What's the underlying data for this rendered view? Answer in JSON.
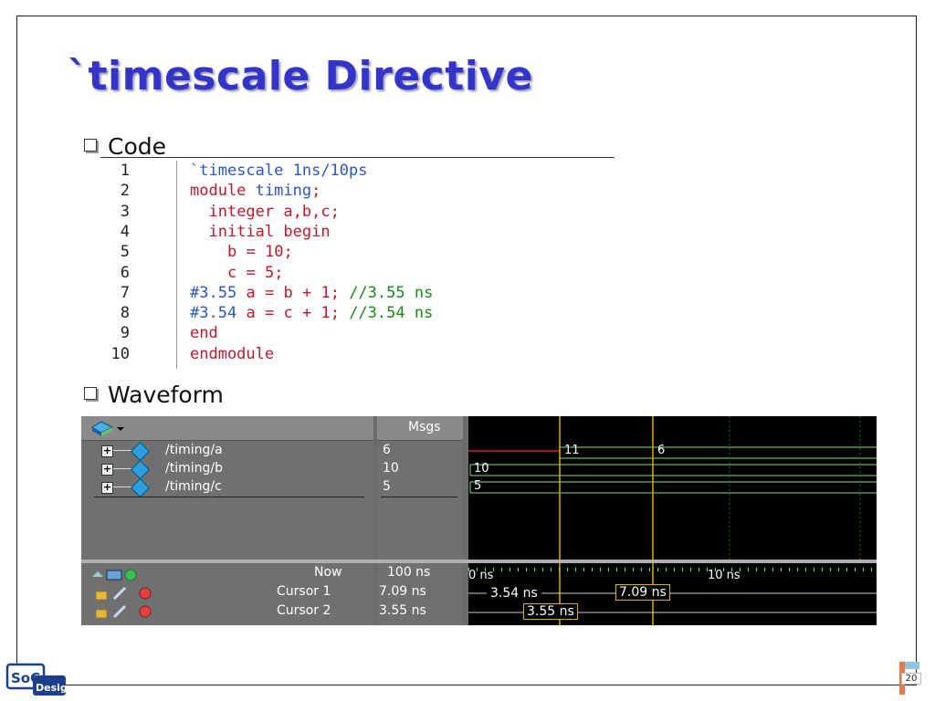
{
  "slide": {
    "title": "`timescale Directive",
    "bullet_code": "Code",
    "bullet_waveform": "Waveform",
    "page_number": "20",
    "logo_text": "SoC Design"
  },
  "code": {
    "lines": [
      {
        "n": "1",
        "text": "`timescale 1ns/10ps"
      },
      {
        "n": "2",
        "text": "module timing;"
      },
      {
        "n": "3",
        "text": "  integer a,b,c;"
      },
      {
        "n": "4",
        "text": "  initial begin"
      },
      {
        "n": "5",
        "text": "    b = 10;"
      },
      {
        "n": "6",
        "text": "    c = 5;"
      },
      {
        "n": "7",
        "text": "#3.55 a = b + 1; //3.55 ns"
      },
      {
        "n": "8",
        "text": "#3.54 a = c + 1; //3.54 ns"
      },
      {
        "n": "9",
        "text": "end"
      },
      {
        "n": "10",
        "text": "endmodule"
      }
    ]
  },
  "waveform": {
    "msgs_header": "Msgs",
    "signals": [
      {
        "name": "/timing/a",
        "msg": "6",
        "segments": [
          "11",
          "6"
        ]
      },
      {
        "name": "/timing/b",
        "msg": "10",
        "segments": [
          "10"
        ]
      },
      {
        "name": "/timing/c",
        "msg": "5",
        "segments": [
          "5"
        ]
      }
    ],
    "now_label": "Now",
    "now_value": "100 ns",
    "cursor1_label": "Cursor 1",
    "cursor1_value": "7.09 ns",
    "cursor2_label": "Cursor 2",
    "cursor2_value": "3.55 ns",
    "ruler_left": "0 ns",
    "ruler_right": "10 ns",
    "cursor_box_a": "3.54 ns",
    "cursor_box_b": "7.09 ns",
    "cursor_box_c": "3.55 ns",
    "colors": {
      "signal_line": "#7fe07f",
      "signal_a_red": "#d02020",
      "cursor": "#d9b000"
    }
  }
}
